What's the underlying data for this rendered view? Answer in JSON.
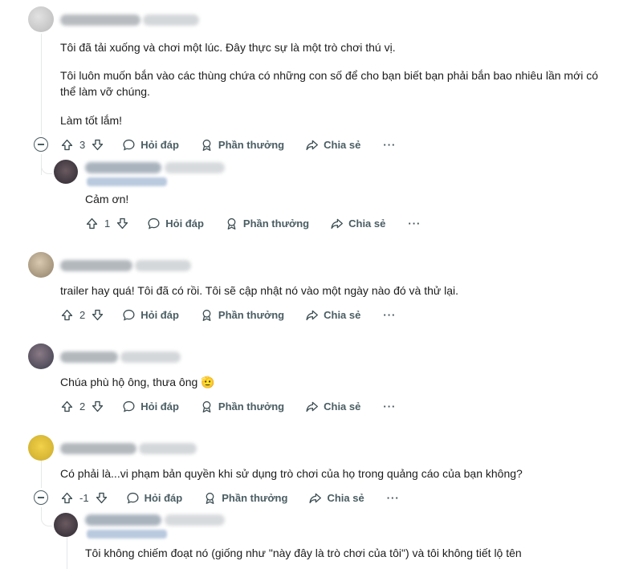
{
  "comments": [
    {
      "text": [
        "Tôi đã tải xuống và chơi một lúc. Đây thực sự là một trò chơi thú vị.",
        "Tôi luôn muốn bắn vào các thùng chứa có những con số để cho bạn biết bạn phải bắn bao nhiêu lần mới có",
        "thể làm vỡ chúng.",
        "Làm tốt lắm!"
      ],
      "votes": "3"
    },
    {
      "text": [
        "Cảm ơn!"
      ],
      "votes": "1"
    },
    {
      "text": [
        "trailer hay quá! Tôi đã có rồi. Tôi sẽ cập nhật nó vào một ngày nào đó và thử lại."
      ],
      "votes": "2"
    },
    {
      "text": [
        "Chúa phù hộ ông, thưa ông 🫡"
      ],
      "votes": "2"
    },
    {
      "text": [
        "Có phải là...vi phạm bản quyền khi sử dụng trò chơi của họ trong quảng cáo của bạn không?"
      ],
      "votes": "-1"
    },
    {
      "text": [
        "Tôi không chiếm đoạt nó (giống như \"này đây là trò chơi của tôi\") và tôi không tiết lộ tên"
      ]
    }
  ],
  "actions": {
    "reply": "Hỏi đáp",
    "award": "Phần thưởng",
    "share": "Chia sẻ",
    "more": "···"
  },
  "colors": {
    "text": "#1c1c1c",
    "meta": "#576f76",
    "thread_line": "#e5e7e9"
  }
}
